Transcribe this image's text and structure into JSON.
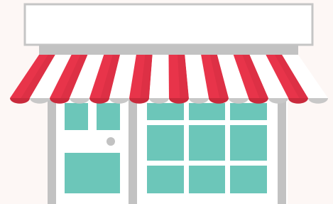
{
  "scene": {
    "subject": "storefront-illustration",
    "sign_text": "",
    "colors": {
      "background": "#fdf7f5",
      "sign_fill": "#ffffff",
      "sign_border": "#c5c5c5",
      "building_gray": "#c2c2c2",
      "building_gray_dark": "#acacac",
      "wall_white": "#ffffff",
      "glass_teal": "#6cc6b9",
      "awning_red": "#e8344a",
      "awning_red_dark": "#c92a3c",
      "awning_white": "#ffffff",
      "awning_gray": "#c8c8c8",
      "door_knob": "#c2c2c2"
    }
  }
}
